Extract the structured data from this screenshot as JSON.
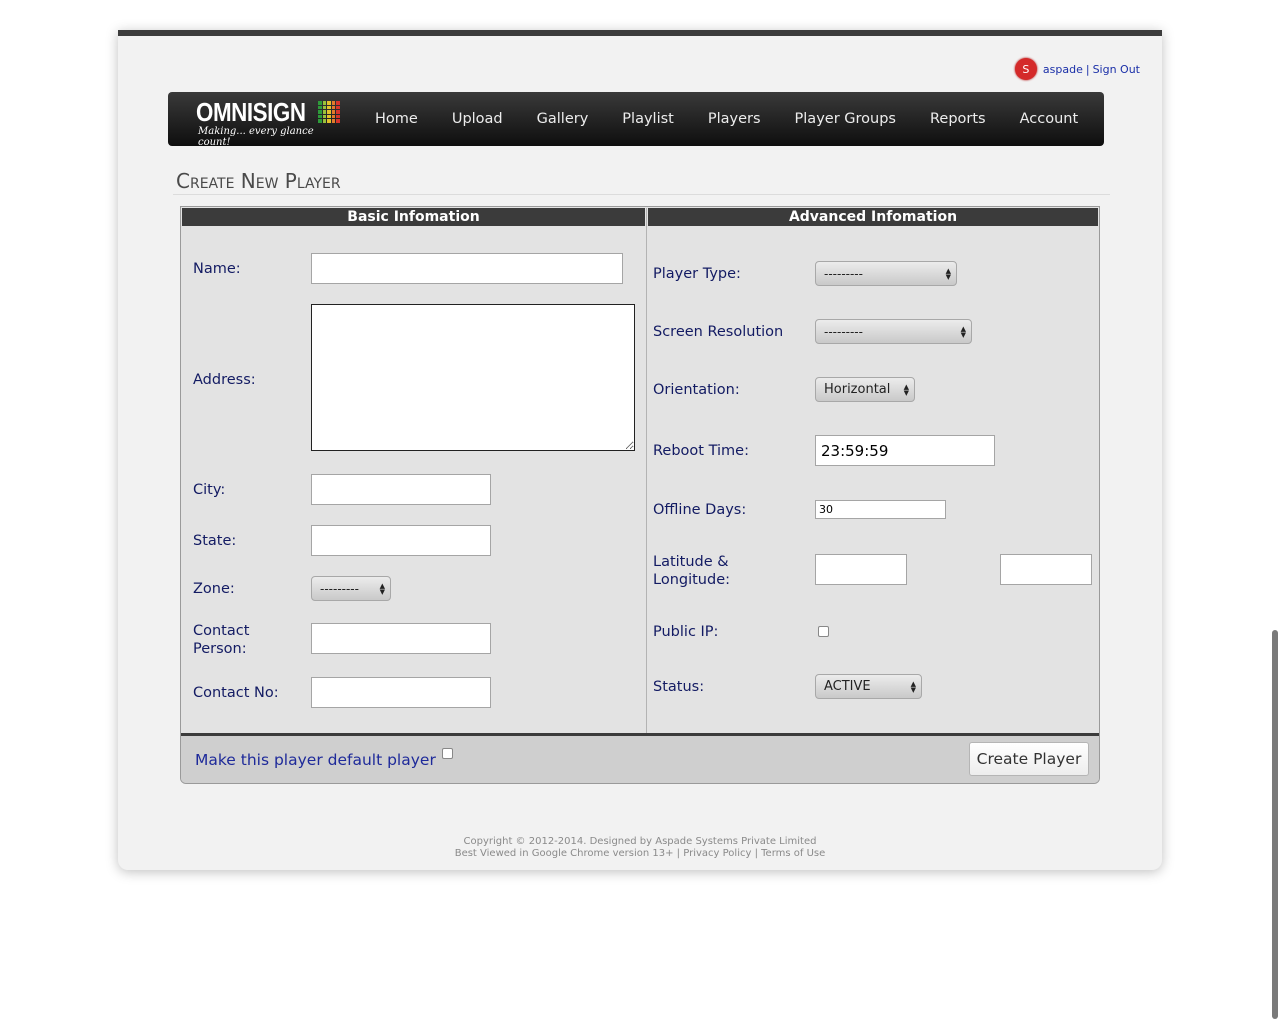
{
  "user": {
    "avatar_letter": "S",
    "username": "aspade",
    "separator": "|",
    "signout": "Sign Out"
  },
  "logo": {
    "word": "OMNISIGN",
    "tagline": "Making... every glance count!",
    "grid_colors": [
      "#2e9b3a",
      "#9bc13a",
      "#e2c12b",
      "#e27a2b",
      "#d8342b"
    ]
  },
  "nav": {
    "items": [
      "Home",
      "Upload",
      "Gallery",
      "Playlist",
      "Players",
      "Player Groups",
      "Reports",
      "Account"
    ]
  },
  "page": {
    "title": "Create New Player"
  },
  "basic": {
    "heading": "Basic Infomation",
    "name_label": "Name:",
    "name_value": "",
    "address_label": "Address:",
    "address_value": "",
    "city_label": "City:",
    "city_value": "",
    "state_label": "State:",
    "state_value": "",
    "zone_label": "Zone:",
    "zone_value": "---------",
    "contact_person_label_1": "Contact",
    "contact_person_label_2": "Person:",
    "contact_person_value": "",
    "contact_no_label": "Contact No:",
    "contact_no_value": ""
  },
  "advanced": {
    "heading": "Advanced Infomation",
    "player_type_label": "Player Type:",
    "player_type_value": "---------",
    "screen_resolution_label": "Screen Resolution",
    "screen_resolution_value": "---------",
    "orientation_label": "Orientation:",
    "orientation_value": "Horizontal",
    "reboot_time_label": "Reboot Time:",
    "reboot_time_value": "23:59:59",
    "offline_days_label": "Offline Days:",
    "offline_days_value": "30",
    "latlong_label_1": "Latitude &",
    "latlong_label_2": "Longitude:",
    "latitude_value": "",
    "longitude_value": "",
    "public_ip_label": "Public IP:",
    "public_ip_checked": false,
    "status_label": "Status:",
    "status_value": "ACTIVE"
  },
  "form_footer": {
    "default_label": "Make this player default player",
    "default_checked": false,
    "create_button": "Create Player"
  },
  "footer": {
    "line1": "Copyright © 2012-2014. Designed by Aspade Systems Private Limited",
    "line2_prefix": "Best Viewed in Google Chrome version 13+",
    "privacy": "Privacy Policy",
    "terms": "Terms of Use",
    "separator": "|"
  }
}
